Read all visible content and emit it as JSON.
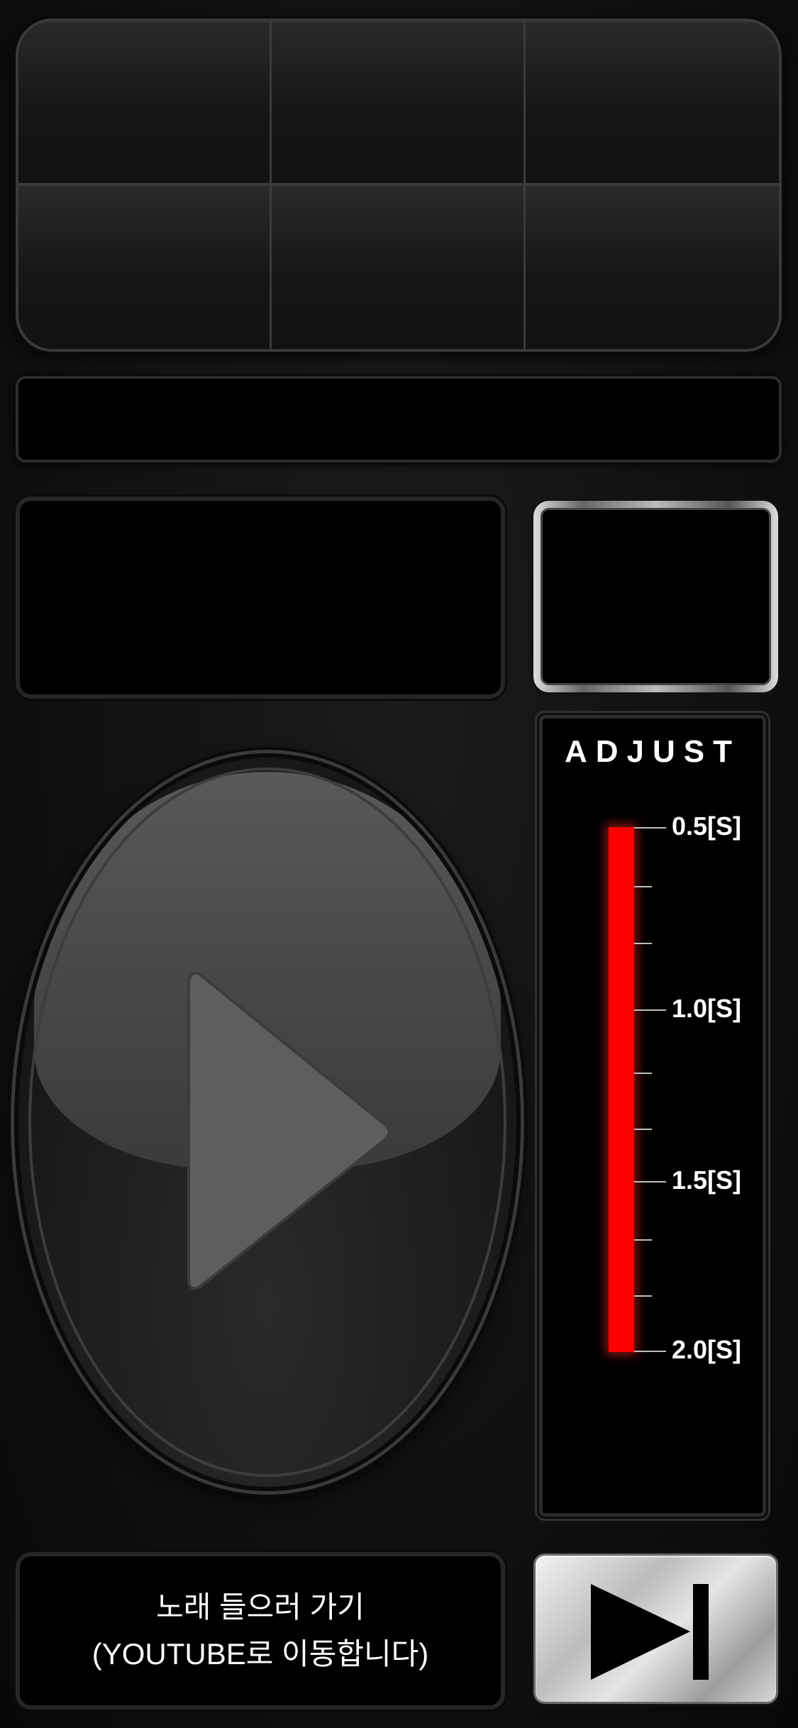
{
  "adjust": {
    "title": "ADJUST",
    "labels": [
      "0.5[S]",
      "1.0[S]",
      "1.5[S]",
      "2.0[S]"
    ],
    "bar_color": "#ff0000"
  },
  "youtube_link": {
    "line1": "노래 들으러 가기",
    "line2": "(YOUTUBE로 이동합니다)"
  },
  "icons": {
    "play": "play-icon",
    "next": "skip-next-icon"
  }
}
